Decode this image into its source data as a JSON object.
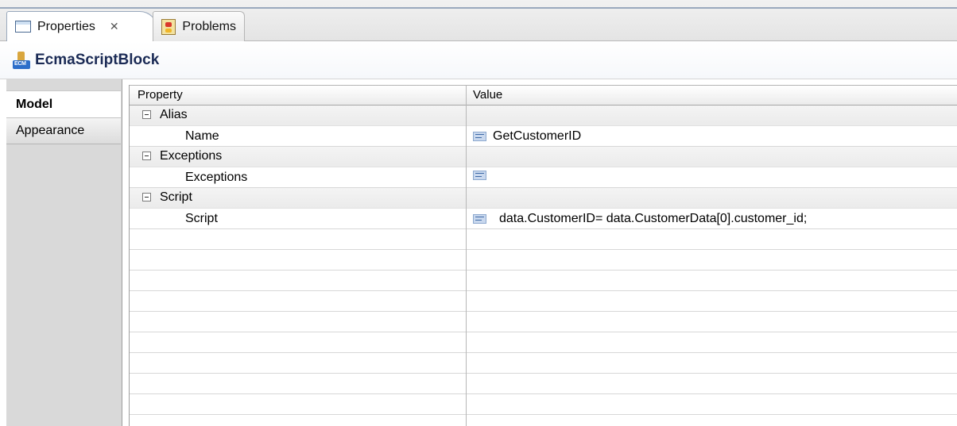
{
  "tabs": [
    {
      "label": "Properties",
      "close_glyph": "✕",
      "icon": "properties-view-icon",
      "active": true
    },
    {
      "label": "Problems",
      "icon": "problems-view-icon",
      "active": false
    }
  ],
  "title": {
    "text": "EcmaScriptBlock",
    "icon": "ecmascript-block-icon",
    "icon_text": "ECM"
  },
  "side_tabs": [
    {
      "label": "Model",
      "active": true
    },
    {
      "label": "Appearance",
      "active": false
    }
  ],
  "table": {
    "headers": {
      "property": "Property",
      "value": "Value"
    },
    "rows": [
      {
        "type": "category",
        "label": "Alias",
        "expanded": true
      },
      {
        "type": "property",
        "label": "Name",
        "value": "GetCustomerID",
        "icon": "text-value-icon"
      },
      {
        "type": "category",
        "label": "Exceptions",
        "expanded": true
      },
      {
        "type": "property",
        "label": "Exceptions",
        "value": "",
        "icon": "text-value-icon"
      },
      {
        "type": "category",
        "label": "Script",
        "expanded": true
      },
      {
        "type": "property",
        "label": "Script",
        "value": "data.CustomerID= data.CustomerData[0].customer_id;",
        "icon": "text-value-icon"
      }
    ]
  },
  "colors": {
    "title_text": "#1a2a55",
    "active_tab_border": "#9aa9bd",
    "panel_bg": "#d9d9d9"
  }
}
